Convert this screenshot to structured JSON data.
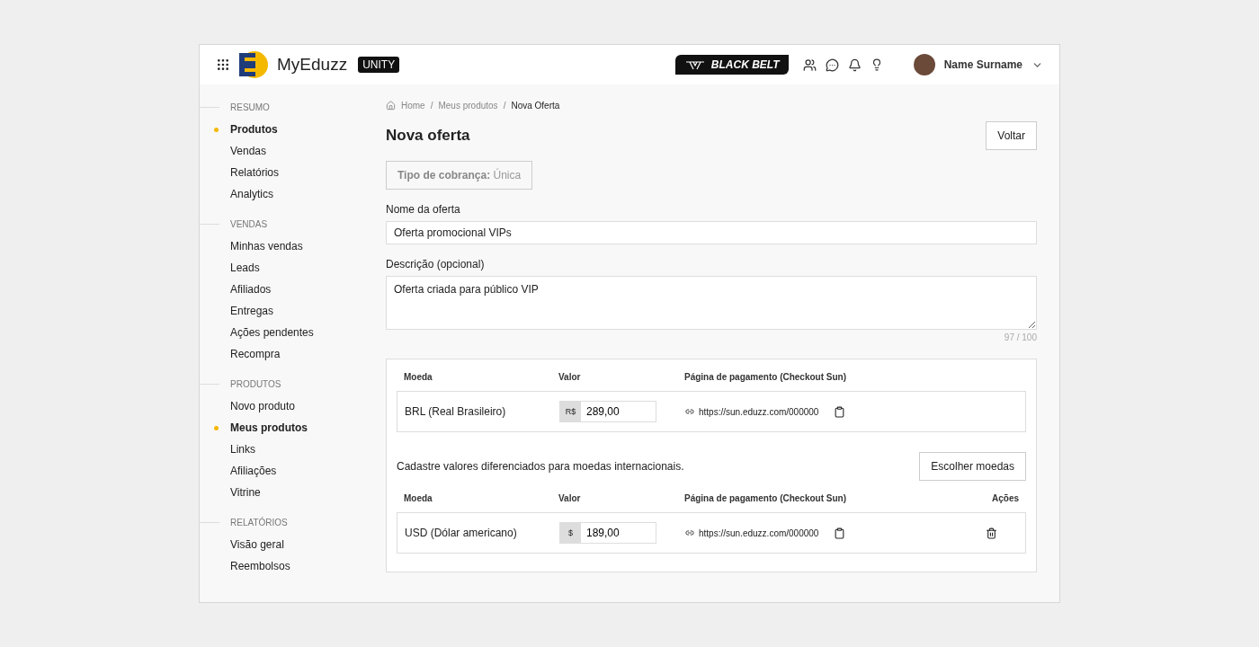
{
  "header": {
    "brand": "MyEduzz",
    "edition": "UNITY",
    "promo": "BLACK BELT",
    "user": "Name Surname"
  },
  "sidebar": [
    {
      "title": "RESUMO",
      "items": [
        {
          "label": "Produtos",
          "selected": true
        },
        {
          "label": "Vendas",
          "selected": false
        },
        {
          "label": "Relatórios",
          "selected": false
        },
        {
          "label": "Analytics",
          "selected": false
        }
      ]
    },
    {
      "title": "VENDAS",
      "items": [
        {
          "label": "Minhas vendas",
          "selected": false
        },
        {
          "label": "Leads",
          "selected": false
        },
        {
          "label": "Afiliados",
          "selected": false
        },
        {
          "label": "Entregas",
          "selected": false
        },
        {
          "label": "Ações pendentes",
          "selected": false
        },
        {
          "label": "Recompra",
          "selected": false
        }
      ]
    },
    {
      "title": "PRODUTOS",
      "items": [
        {
          "label": "Novo produto",
          "selected": false
        },
        {
          "label": "Meus produtos",
          "selected": true
        },
        {
          "label": "Links",
          "selected": false
        },
        {
          "label": "Afiliações",
          "selected": false
        },
        {
          "label": "Vitrine",
          "selected": false
        }
      ]
    },
    {
      "title": "RELATÓRIOS",
      "items": [
        {
          "label": "Visão geral",
          "selected": false
        },
        {
          "label": "Reembolsos",
          "selected": false
        }
      ]
    }
  ],
  "breadcrumb": [
    "Home",
    "Meus produtos",
    "Nova Oferta"
  ],
  "breadcrumb_separator": "/",
  "title": "Nova oferta",
  "back_button": "Voltar",
  "billing": "**Tipo de cobrança:** Única",
  "name_field": {
    "label": "Nome da oferta",
    "value": "Oferta promocional VIPs"
  },
  "description_field": {
    "label": "Descrição (opcional)",
    "value": "Oferta criada para público VIP",
    "counter": "97 / 100"
  },
  "main_table": {
    "columns": [
      "Moeda",
      "Valor",
      "Página de pagamento (Checkout Sun)"
    ],
    "rows": [
      {
        "currency": "BRL (Real Brasileiro)",
        "symbol": "R$",
        "value": "289,00",
        "url": "https://sun.eduzz.com/000000"
      }
    ]
  },
  "international": {
    "text": "Cadastre valores diferenciados para moedas internacionais.",
    "button": "Escolher moedas"
  },
  "intl_table": {
    "columns": [
      "Moeda",
      "Valor",
      "Página de pagamento (Checkout Sun)",
      "Ações"
    ],
    "rows": [
      {
        "currency": "USD (Dólar americano)",
        "symbol": "$",
        "value": "189,00",
        "url": "https://sun.eduzz.com/000000"
      }
    ]
  }
}
